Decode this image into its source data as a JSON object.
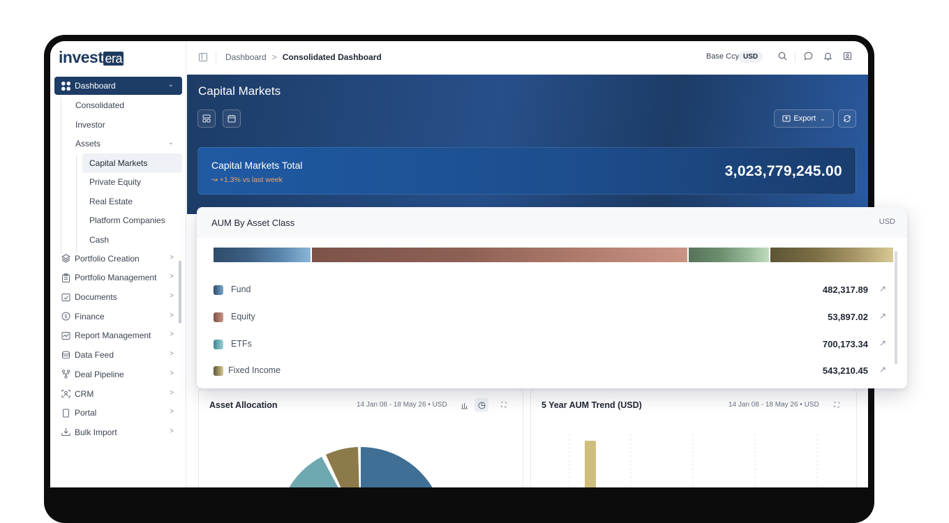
{
  "logo": {
    "main": "invest",
    "suffix": "era"
  },
  "sidebar": {
    "dashboard": "Dashboard",
    "consolidated": "Consolidated",
    "investor": "Investor",
    "assets": "Assets",
    "assets_items": [
      "Capital Markets",
      "Private Equity",
      "Real Estate",
      "Platform Companies",
      "Cash"
    ],
    "items": [
      "Portfolio Creation",
      "Portfolio Management",
      "Documents",
      "Finance",
      "Report Management",
      "Data Feed",
      "Deal Pipeline",
      "CRM",
      "Portal",
      "Bulk Import"
    ]
  },
  "topbar": {
    "crumb1": "Dashboard",
    "crumb_sep": ">",
    "crumb2": "Consolidated Dashboard",
    "base_ccy_label": "Base Ccy",
    "base_ccy_value": "USD"
  },
  "hero": {
    "title": "Capital Markets",
    "export_label": "Export",
    "total_label": "Capital Markets Total",
    "total_delta": "+1.3% vs last week",
    "total_value": "3,023,779,245.00"
  },
  "popup": {
    "title": "AUM By Asset Class",
    "currency": "USD",
    "rows": [
      {
        "label": "Fund",
        "value": "482,317.89",
        "color": "#3f6f94"
      },
      {
        "label": "Equity",
        "value": "53,897.02",
        "color": "#8f5c52"
      },
      {
        "label": "ETFs",
        "value": "700,173.34",
        "color": "#4f9aa3"
      },
      {
        "label": "Fixed Income",
        "value": "543,210.45",
        "color": "#7a6a40"
      }
    ]
  },
  "cards": {
    "allocation": {
      "title": "Asset Allocation",
      "meta": "14 Jan 08 - 18 May 26 • USD"
    },
    "trend": {
      "title": "5 Year AUM Trend (USD)",
      "meta": "14 Jan 08 - 18 May 26 • USD"
    }
  },
  "colors": {
    "brand": "#1d3c66",
    "accent": "#f0a468"
  }
}
